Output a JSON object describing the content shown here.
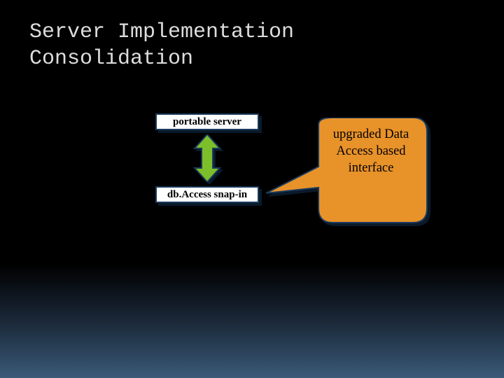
{
  "title_line1": "Server Implementation",
  "title_line2": "Consolidation",
  "box_top": "portable server",
  "box_bottom": "db.Access snap-in",
  "callout": "upgraded Data Access based interface",
  "colors": {
    "arrow_fill": "#7cbf2a",
    "arrow_stroke": "#1a3a5c",
    "callout_fill": "#e8922a",
    "callout_stroke": "#1a3a5c"
  }
}
